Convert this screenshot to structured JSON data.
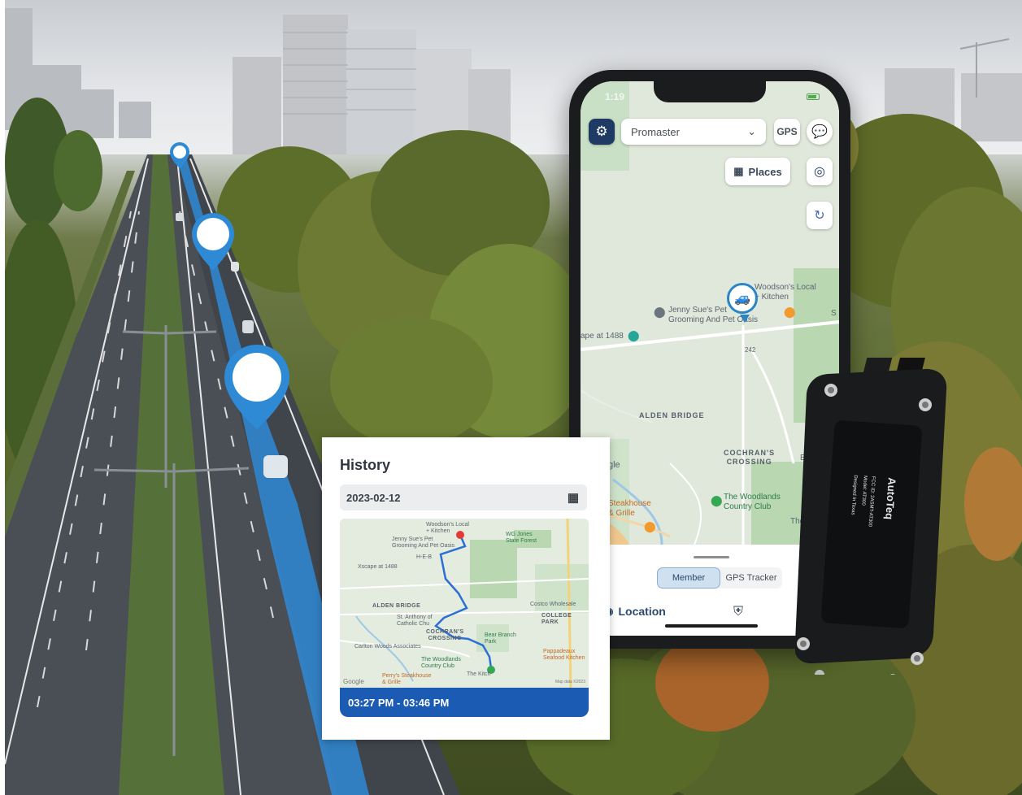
{
  "phone": {
    "status_time": "1:19",
    "vehicle_select": "Promaster",
    "gps_label": "GPS",
    "places_label": "Places",
    "map_labels": {
      "woodson": "Woodson's Local\n+ Kitchen",
      "jenny": "Jenny Sue's Pet\nGrooming And Pet Oasis",
      "escape": "ape at 1488",
      "road_242": "242",
      "alden_bridge": "ALDEN BRIDGE",
      "cochrans": "COCHRAN'S\nCROSSING",
      "woodlands_cc": "The Woodlands\nCountry Club",
      "steakhouse": "Steakhouse\n& Grille",
      "gle": "gle",
      "be": "Be",
      "the": "The",
      "s_edge": "S"
    },
    "tabs": [
      "Member",
      "GPS Tracker"
    ],
    "active_tab": "Member",
    "nav_location": "Location"
  },
  "history": {
    "title": "History",
    "date": "2023-02-12",
    "time_range": "03:27 PM - 03:46 PM",
    "map_labels": {
      "woodson": "Woodson's Local\n+ Kitchen",
      "jenny": "Jenny Sue's Pet\nGrooming And Pet Oasis",
      "wg_jones": "WG Jones\nState Forest",
      "hmart": "H-E-B",
      "escape": "Xscape at 1488",
      "alden_bridge": "ALDEN BRIDGE",
      "st_anthony": "St. Anthony of\nCatholic Chu",
      "costco": "Costco Wholesale",
      "college_park": "COLLEGE PARK",
      "bear_branch": "Bear Branch\nPark",
      "cochrans": "COCHRAN'S\nCROSSING",
      "carlton": "Carlton Woods Associates",
      "woodlands_cc": "The Woodlands\nCountry Club",
      "pappadeaux": "Pappadeaux\nSeafood Kitchen",
      "perrys": "Perry's Steakhouse\n& Grille",
      "kitchen": "The Kitch",
      "google": "Google",
      "attribution": "Map data ©2023"
    }
  },
  "device": {
    "brand": "AutoTeq",
    "model": "Model: AT300",
    "fcc": "FCC ID: 2ASMT-AT300",
    "tag": "Designed In Texas"
  },
  "colors": {
    "accent_blue": "#1c5bb4",
    "route_blue": "#2b84c7",
    "settings_navy": "#1f3b63"
  }
}
